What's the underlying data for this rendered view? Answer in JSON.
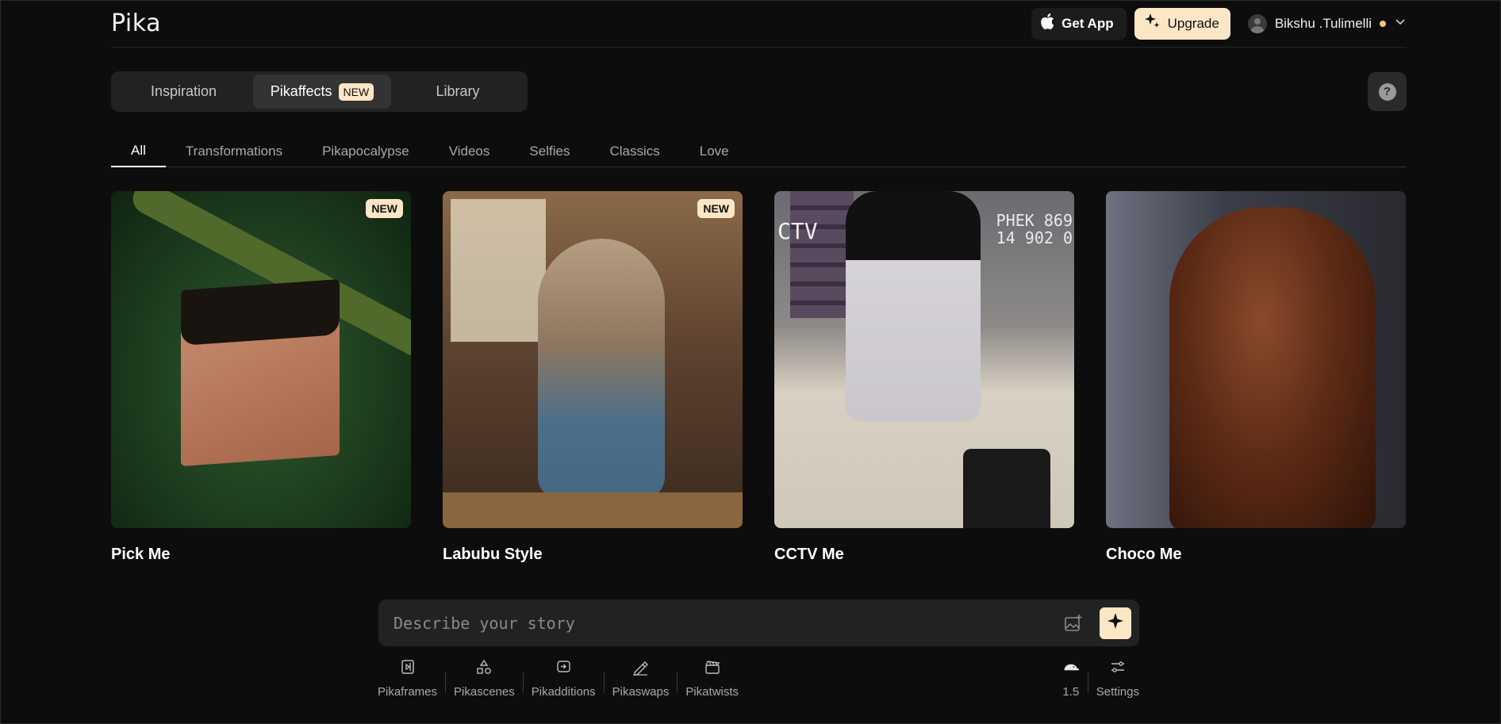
{
  "header": {
    "logo": "Pika",
    "get_app_label": "Get App",
    "upgrade_label": "Upgrade",
    "user_name": "Bikshu .Tulimelli"
  },
  "main_tabs": [
    {
      "label": "Inspiration",
      "active": false
    },
    {
      "label": "Pikaffects",
      "active": true,
      "badge": "NEW"
    },
    {
      "label": "Library",
      "active": false
    }
  ],
  "help_label": "?",
  "categories": [
    {
      "label": "All",
      "active": true
    },
    {
      "label": "Transformations",
      "active": false
    },
    {
      "label": "Pikapocalypse",
      "active": false
    },
    {
      "label": "Videos",
      "active": false
    },
    {
      "label": "Selfies",
      "active": false
    },
    {
      "label": "Classics",
      "active": false
    },
    {
      "label": "Love",
      "active": false
    }
  ],
  "cards": [
    {
      "title": "Pick Me",
      "badge": "NEW"
    },
    {
      "title": "Labubu Style",
      "badge": "NEW"
    },
    {
      "title": "CCTV Me",
      "badge": "",
      "overlay_left": "CTV",
      "overlay_right_1": "PHEK 869",
      "overlay_right_2": "14 902 0"
    },
    {
      "title": "Choco Me",
      "badge": ""
    }
  ],
  "prompt": {
    "placeholder": "Describe your story"
  },
  "tools": [
    {
      "label": "Pikaframes",
      "icon": "frames-icon"
    },
    {
      "label": "Pikascenes",
      "icon": "shapes-icon"
    },
    {
      "label": "Pikadditions",
      "icon": "add-icon"
    },
    {
      "label": "Pikaswaps",
      "icon": "swap-brush-icon"
    },
    {
      "label": "Pikatwists",
      "icon": "clapper-icon"
    }
  ],
  "model_version": "1.5",
  "settings_label": "Settings",
  "colors": {
    "background": "#0d0d0d",
    "accent": "#fbe6c6",
    "status_dot": "#f5c27a"
  }
}
